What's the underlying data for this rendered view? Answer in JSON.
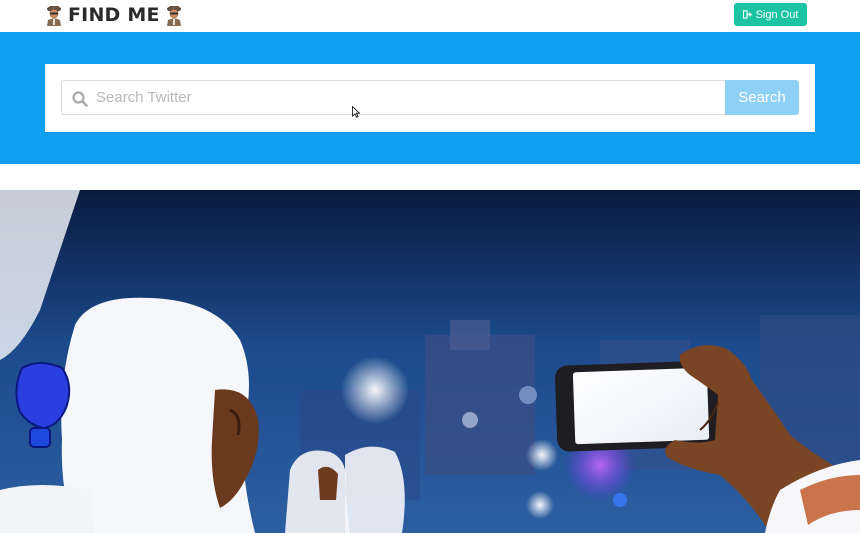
{
  "navbar": {
    "brand_text": "FIND ME",
    "signout_label": "Sign Out"
  },
  "search": {
    "placeholder": "Search Twitter",
    "value": "",
    "button_label": "Search"
  },
  "colors": {
    "hero_band": "#119ff2",
    "signout_bg": "#1cc4a4",
    "search_button_bg": "#8fd0f7"
  },
  "icons": {
    "brand_left": "detective-icon",
    "brand_right": "detective-icon",
    "signout": "sign-out-icon",
    "search_field": "search-icon"
  }
}
